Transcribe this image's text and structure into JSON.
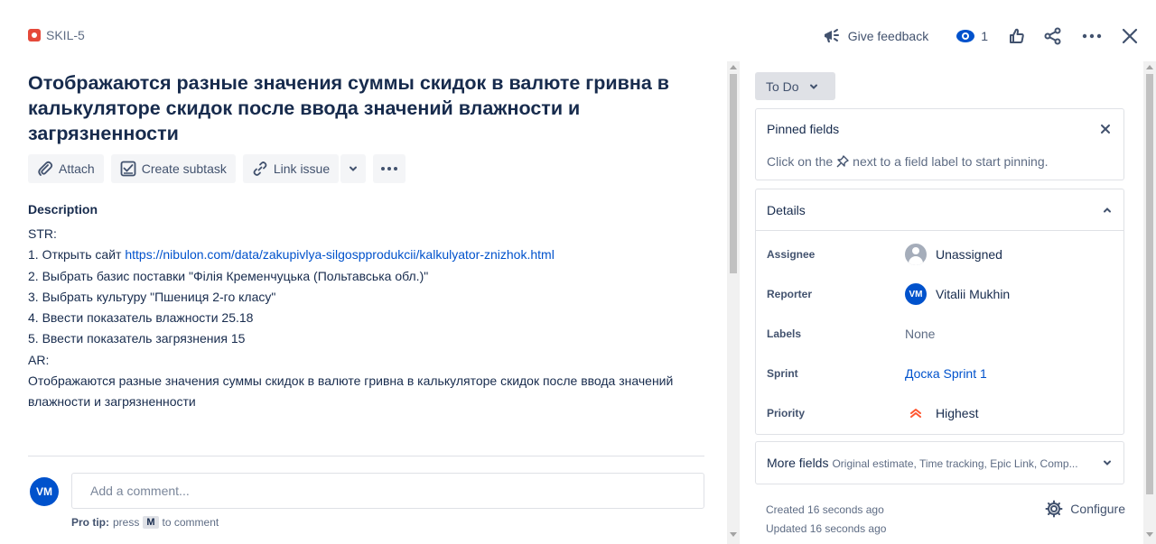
{
  "header": {
    "issue_key": "SKIL-5",
    "feedback_label": "Give feedback",
    "watch_count": "1"
  },
  "issue": {
    "title": "Отображаются разные значения суммы скидок в валюте гривна в калькуляторе скидок после ввода значений влажности и загрязненности"
  },
  "toolbar": {
    "attach_label": "Attach",
    "create_subtask_label": "Create subtask",
    "link_issue_label": "Link issue"
  },
  "description": {
    "label": "Description",
    "str": "STR:",
    "step1_prefix": "1. Открыть сайт ",
    "step1_link": "https://nibulon.com/data/zakupivlya-silgospprodukcii/kalkulyator-znizhok.html",
    "step2": "2. Выбрать базис поставки \"Філія Кременчуцька (Польтавська обл.)\"",
    "step3": "3. Выбрать культуру \"Пшениця 2-го класу\"",
    "step4": "4. Ввести показатель влажности 25.18",
    "step5": "5. Ввести показатель загрязнения 15",
    "ar": "AR:",
    "ar_text": "Отображаются разные значения суммы скидок в валюте гривна в калькуляторе скидок после ввода значений влажности и загрязненности"
  },
  "comment": {
    "avatar_initials": "VM",
    "placeholder": "Add a comment...",
    "protip_label": "Pro tip:",
    "protip_press": "press",
    "protip_key": "M",
    "protip_suffix": "to comment"
  },
  "sidebar": {
    "status_label": "To Do",
    "pinned": {
      "title": "Pinned fields",
      "hint_before": "Click on the",
      "hint_after": "next to a field label to start pinning."
    },
    "details": {
      "title": "Details",
      "assignee_label": "Assignee",
      "assignee_value": "Unassigned",
      "reporter_label": "Reporter",
      "reporter_initials": "VM",
      "reporter_value": "Vitalii Mukhin",
      "labels_label": "Labels",
      "labels_value": "None",
      "sprint_label": "Sprint",
      "sprint_value": "Доска Sprint 1",
      "priority_label": "Priority",
      "priority_value": "Highest"
    },
    "more_fields": {
      "title": "More fields",
      "subtitle": "Original estimate, Time tracking, Epic Link, Comp..."
    },
    "created": "Created 16 seconds ago",
    "updated": "Updated 16 seconds ago",
    "configure_label": "Configure"
  },
  "colors": {
    "accent": "#0052CC",
    "bug": "#E5493A",
    "priority_highest": "#FF5630"
  },
  "icons": {
    "bug": "bug-icon",
    "feedback": "megaphone-icon",
    "watch": "eye-icon",
    "like": "thumbs-up-icon",
    "share": "share-icon",
    "more": "more-icon",
    "close": "close-icon",
    "attach": "paperclip-icon",
    "subtask": "subtask-icon",
    "link": "link-icon",
    "pin": "pin-icon",
    "configure": "gear-icon"
  }
}
